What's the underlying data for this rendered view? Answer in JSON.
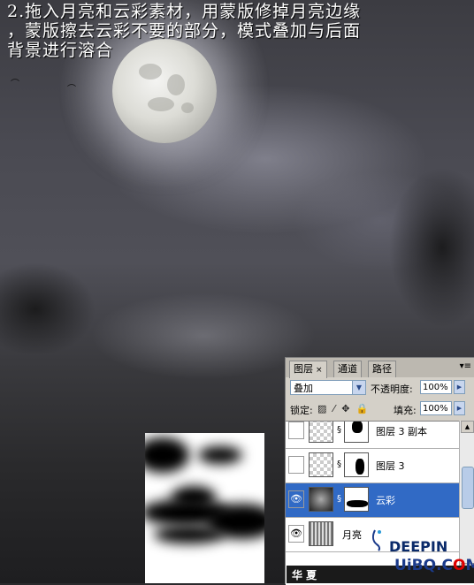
{
  "tutorial": {
    "lines": [
      "2.拖入月亮和云彩素材，用蒙版修掉月亮边缘",
      "，蒙版擦去云彩不要的部分，模式叠加与后面",
      "背景进行溶合"
    ]
  },
  "layers_panel": {
    "tabs": [
      {
        "label": "图层",
        "active": true
      },
      {
        "label": "通道",
        "active": false
      },
      {
        "label": "路径",
        "active": false
      }
    ],
    "close_glyph": "×",
    "menu_glyph": "▾≡",
    "blend_mode": "叠加",
    "opacity_label": "不透明度:",
    "opacity_value": "100%",
    "lock_label": "锁定:",
    "lock_icons": "▨ ⁄ ✥ 🔒",
    "fill_label": "填充:",
    "fill_value": "100%",
    "layers": [
      {
        "name": "图层 3 副本",
        "visible": false,
        "selected": false
      },
      {
        "name": "图层 3",
        "visible": false,
        "selected": false
      },
      {
        "name": "云彩",
        "visible": true,
        "selected": true
      },
      {
        "name": "月亮",
        "visible": true,
        "selected": false
      }
    ],
    "eye_glyph": "👁",
    "chain_glyph": "§"
  },
  "watermark": {
    "brand": "DEEPIN",
    "site_prefix": "U",
    "site_mid": "i",
    "site_b": "B",
    "site_q": "Q",
    "site_dot": ".",
    "site_com": "C",
    "site_o": "O",
    "site_m": "M",
    "bottom_text": "华 夏"
  },
  "colors": {
    "selection": "#316ac5",
    "watermark_blue": "#0a2a6a",
    "watermark_red": "#dd0000"
  }
}
